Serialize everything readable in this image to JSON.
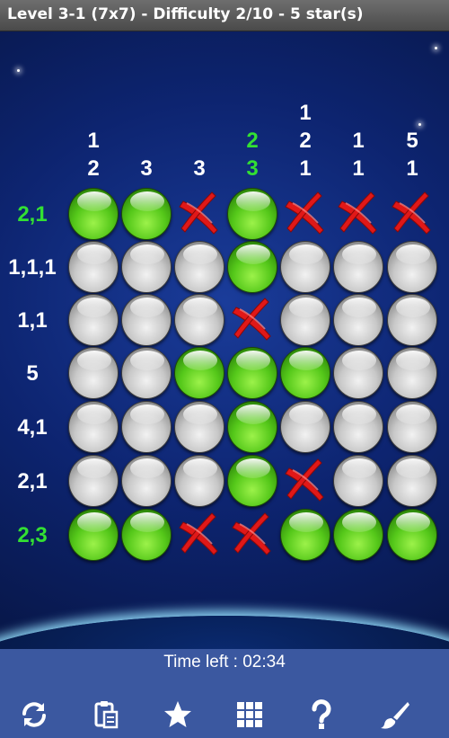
{
  "title": "Level 3-1 (7x7) - Difficulty 2/10 - 5 star(s)",
  "col_clues": [
    {
      "lines": [
        "1",
        "2"
      ],
      "solved": false
    },
    {
      "lines": [
        "3"
      ],
      "solved": false
    },
    {
      "lines": [
        "3"
      ],
      "solved": false
    },
    {
      "lines": [
        "2",
        "3"
      ],
      "solved": true
    },
    {
      "lines": [
        "1",
        "2",
        "1"
      ],
      "solved": false
    },
    {
      "lines": [
        "1",
        "1"
      ],
      "solved": false
    },
    {
      "lines": [
        "5",
        "1"
      ],
      "solved": false
    }
  ],
  "row_clues": [
    {
      "text": "2,1",
      "solved": true
    },
    {
      "text": "1,1,1",
      "solved": false
    },
    {
      "text": "1,1",
      "solved": false
    },
    {
      "text": "5",
      "solved": false
    },
    {
      "text": "4,1",
      "solved": false
    },
    {
      "text": "2,1",
      "solved": false
    },
    {
      "text": "2,3",
      "solved": true
    }
  ],
  "grid": [
    [
      "filled",
      "filled",
      "crossed",
      "filled",
      "crossed",
      "crossed",
      "crossed"
    ],
    [
      "empty",
      "empty",
      "empty",
      "filled",
      "empty",
      "empty",
      "empty"
    ],
    [
      "empty",
      "empty",
      "empty",
      "crossed",
      "empty",
      "empty",
      "empty"
    ],
    [
      "empty",
      "empty",
      "filled",
      "filled",
      "filled",
      "empty",
      "empty"
    ],
    [
      "empty",
      "empty",
      "empty",
      "filled",
      "empty",
      "empty",
      "empty"
    ],
    [
      "empty",
      "empty",
      "empty",
      "filled",
      "crossed",
      "empty",
      "empty"
    ],
    [
      "filled",
      "filled",
      "crossed",
      "crossed",
      "filled",
      "filled",
      "filled"
    ]
  ],
  "timer": {
    "text": "Time left : 02:34"
  },
  "toolbar": [
    {
      "name": "refresh-button",
      "icon": "refresh-icon"
    },
    {
      "name": "clipboard-button",
      "icon": "clipboard-icon"
    },
    {
      "name": "star-button",
      "icon": "star-icon"
    },
    {
      "name": "grid-button",
      "icon": "grid-icon"
    },
    {
      "name": "help-button",
      "icon": "help-icon"
    },
    {
      "name": "brush-button",
      "icon": "brush-icon"
    }
  ],
  "colors": {
    "solved_clue": "#33e033",
    "clue": "#ffffff",
    "bottom_bar": "#3b58a0",
    "cross": "#e01818"
  }
}
